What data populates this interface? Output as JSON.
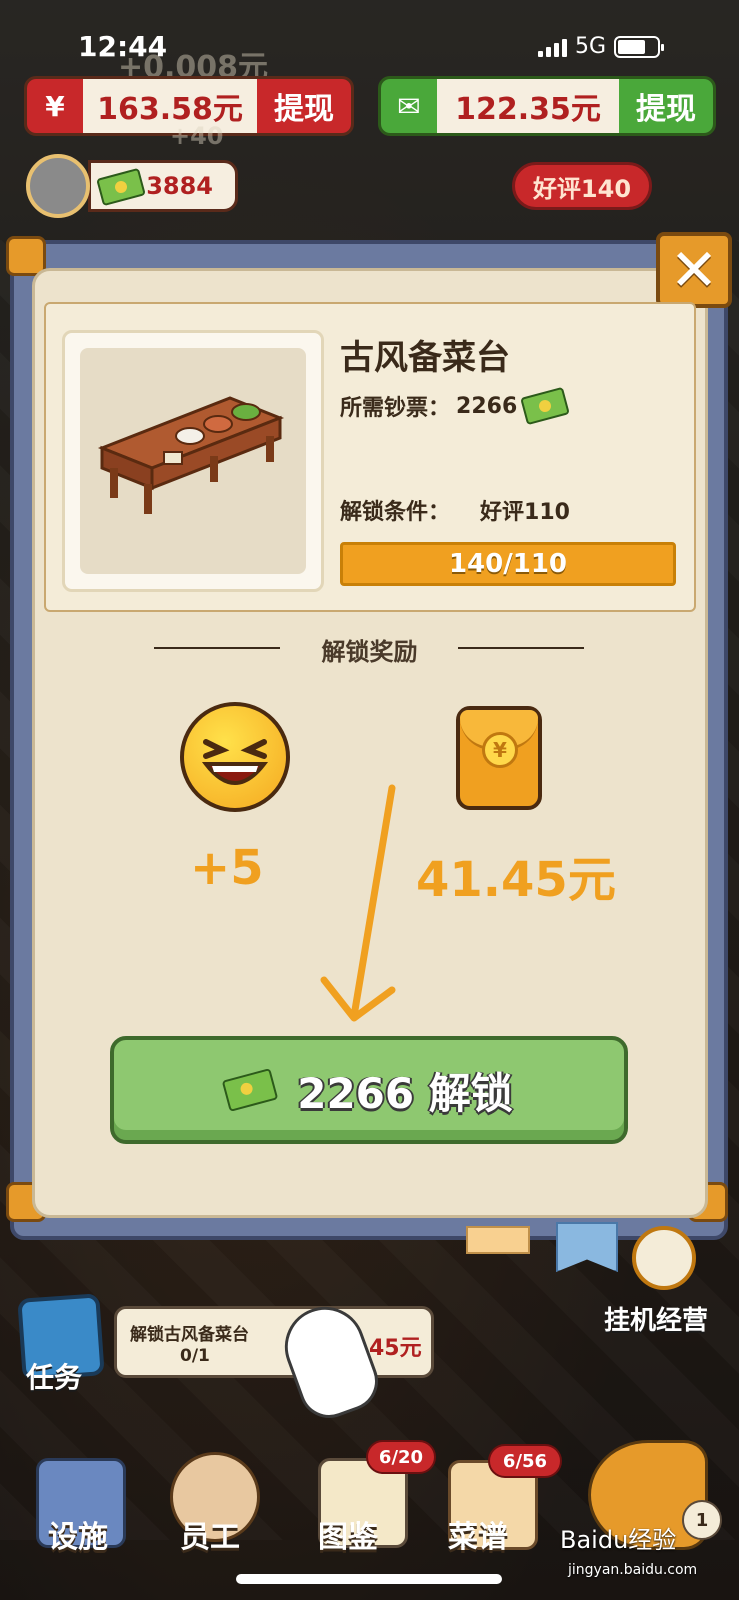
{
  "status_bar": {
    "time": "12:44",
    "network": "5G"
  },
  "top_bar": {
    "red_balance": "163.58元",
    "red_withdraw_label": "提现",
    "green_balance": "122.35元",
    "green_withdraw_label": "提现",
    "ghost_income": "+0.008元",
    "ghost_cash": "+40",
    "cash_amount": "3884",
    "review_badge": "好评140",
    "colors": {
      "red": "#c8282a",
      "green": "#4aa83a"
    }
  },
  "modal": {
    "item_name": "古风备菜台",
    "cost_label": "所需钞票：",
    "cost_value": "2266",
    "condition_label": "解锁条件：",
    "condition_value": "好评110",
    "progress_text": "140/110",
    "progress_fraction": 1.0,
    "reward_title": "解锁奖励",
    "rewards": [
      {
        "icon": "laughing-emoji-icon",
        "value": "+5"
      },
      {
        "icon": "red-envelope-icon",
        "value": "41.45元"
      }
    ],
    "unlock_button_label": "2266 解锁",
    "close_icon": "close-icon",
    "accent_color": "#f0a020"
  },
  "task": {
    "label": "任务",
    "name": "解锁古风备菜台",
    "progress": "0/1",
    "reward": "41.45元"
  },
  "idle": {
    "label": "挂机经营"
  },
  "nav": {
    "items": [
      {
        "label": "设施"
      },
      {
        "label": "员工"
      },
      {
        "label": "图鉴",
        "badge": "6/20"
      },
      {
        "label": "菜谱",
        "badge": "6/56"
      }
    ],
    "horn_badge": "1"
  },
  "watermark": {
    "brand": "Baidu经验",
    "url": "jingyan.baidu.com"
  }
}
